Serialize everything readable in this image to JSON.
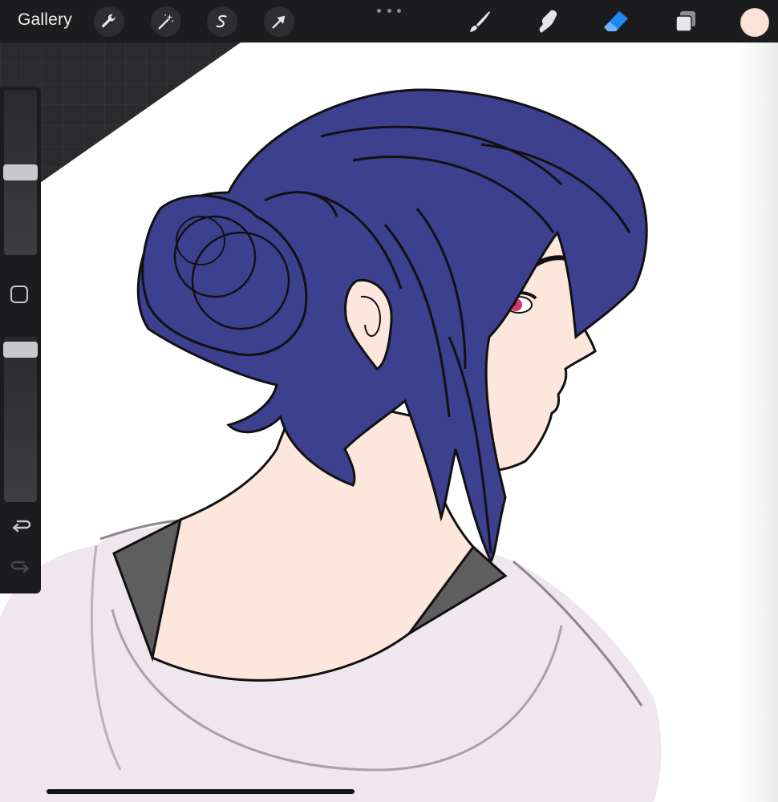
{
  "toolbar": {
    "gallery_label": "Gallery",
    "actions": [
      {
        "name": "actions",
        "icon": "wrench-icon"
      },
      {
        "name": "adjustments",
        "icon": "magic-wand-icon"
      },
      {
        "name": "selection",
        "icon": "selection-s-icon"
      },
      {
        "name": "transform",
        "icon": "arrow-cursor-icon"
      }
    ],
    "tools": [
      {
        "name": "brush",
        "icon": "brush-icon",
        "active": false
      },
      {
        "name": "smudge",
        "icon": "smudge-finger-icon",
        "active": false
      },
      {
        "name": "eraser",
        "icon": "eraser-icon",
        "active": true
      },
      {
        "name": "layers",
        "icon": "layers-icon",
        "active": false
      }
    ],
    "more_icon": "more-dots-icon",
    "current_color": "#fde3d6",
    "active_tool_color": "#1c8bf5"
  },
  "sidebar": {
    "brush_size_level": 0.5,
    "opacity_level": 0.97,
    "modify_icon": "square-modify-icon",
    "undo_icon": "undo-icon",
    "redo_icon": "redo-icon"
  },
  "canvas": {
    "hair_color": "#3d3f8f",
    "skin_color": "#fde6dc",
    "hoodie_color": "#efe6ee",
    "collar_color": "#5e5e5e",
    "line_color": "#111111",
    "eye_color": "#cf3a6a",
    "background_color": "#ffffff"
  }
}
